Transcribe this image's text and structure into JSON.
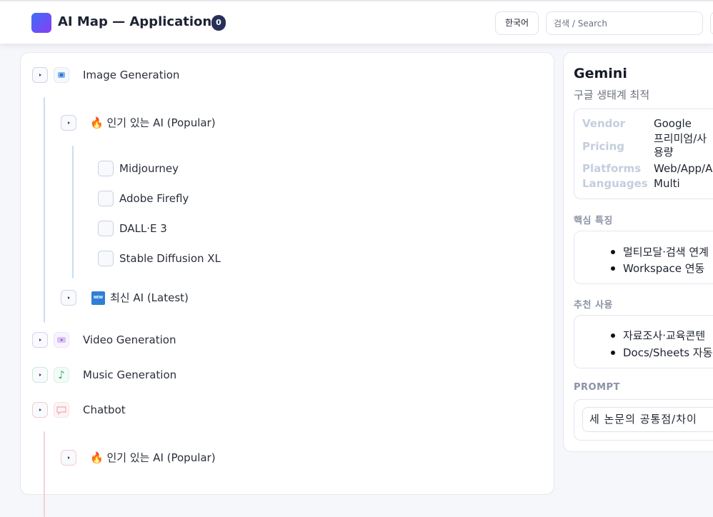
{
  "header": {
    "title": "AI Map — Applications",
    "count": "0",
    "lang_button": "한국어",
    "search_placeholder": "검색 / Search"
  },
  "colors": {
    "accent_gradient_start": "#3b6ff7",
    "accent_gradient_end": "#8a3cf5",
    "badge_bg": "#27305a"
  },
  "tree": {
    "image": {
      "label": "Image Generation",
      "icon": "camera-icon",
      "popular": {
        "label": "🔥 인기 있는 AI (Popular)",
        "items": [
          "Midjourney",
          "Adobe Firefly",
          "DALL·E 3",
          "Stable Diffusion XL"
        ]
      },
      "latest": {
        "label": "최신 AI (Latest)",
        "icon": "new-icon",
        "icon_text": "NEW"
      }
    },
    "video": {
      "label": "Video Generation",
      "icon": "video-icon"
    },
    "music": {
      "label": "Music Generation",
      "icon": "music-note-icon",
      "icon_glyph": "♪"
    },
    "chatbot": {
      "label": "Chatbot",
      "icon": "chat-icon",
      "popular": {
        "label": "🔥 인기 있는 AI (Popular)"
      }
    }
  },
  "detail": {
    "title": "Gemini",
    "subtitle": "구글 생태계 최적",
    "fields": {
      "vendor_key": "Vendor",
      "vendor_val": "Google",
      "pricing_key": "Pricing",
      "pricing_val_1": "프리미엄/사",
      "pricing_val_2": "용량",
      "platforms_key": "Platforms",
      "platforms_val": "Web/App/A",
      "languages_key": "Languages",
      "languages_val": "Multi"
    },
    "features_title": "핵심 특징",
    "features": [
      "멀티모달·검색 연계",
      "Workspace 연동"
    ],
    "usage_title": "추천 사용",
    "usage": [
      "자료조사·교육콘텐",
      "Docs/Sheets 자동"
    ],
    "prompt_title": "PROMPT",
    "prompt_value": "세 논문의 공통점/차이"
  }
}
